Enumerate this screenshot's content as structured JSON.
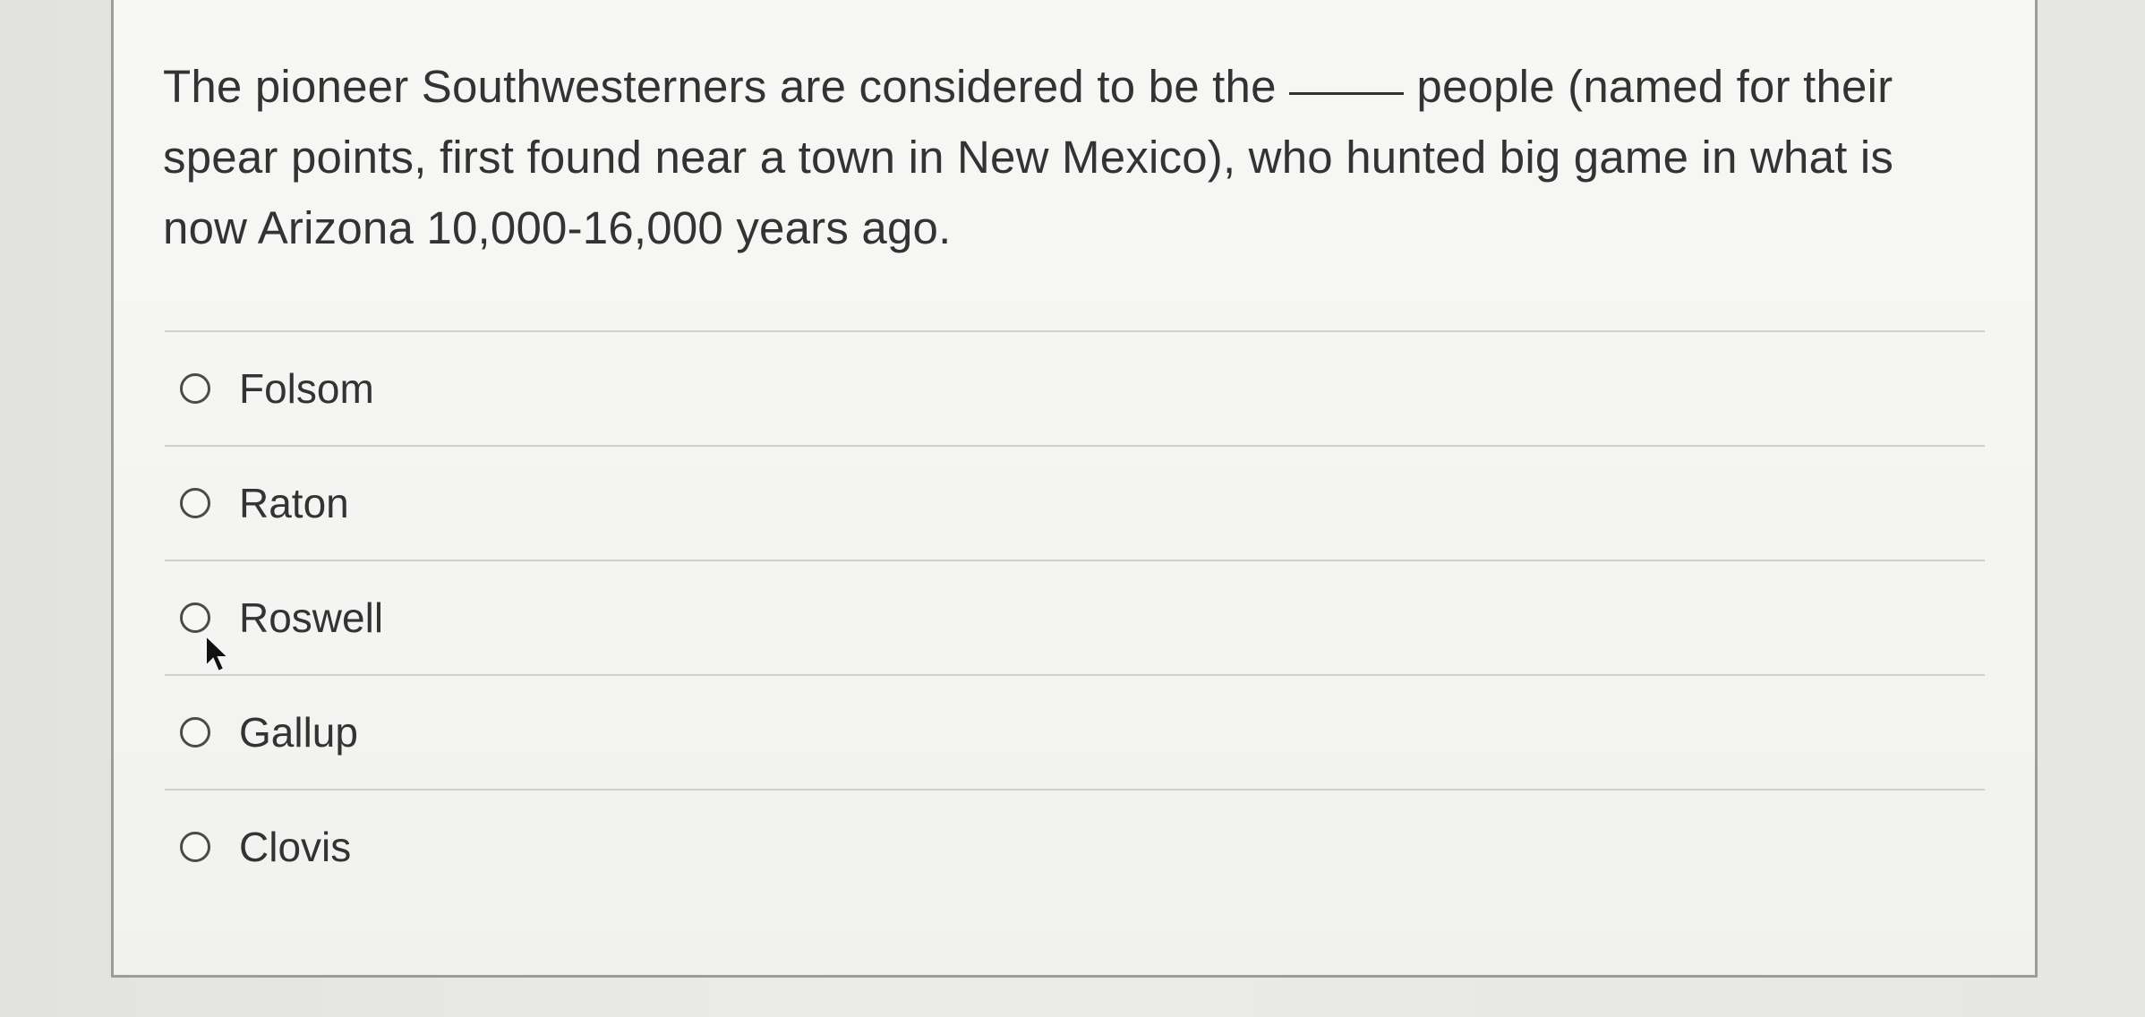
{
  "question": {
    "text_before": "The pioneer Southwesterners are considered to be the",
    "text_after": "people (named for their spear points, first found near a town in New Mexico), who hunted big game in what is now Arizona 10,000-16,000 years ago."
  },
  "options": [
    {
      "label": "Folsom"
    },
    {
      "label": "Raton"
    },
    {
      "label": "Roswell"
    },
    {
      "label": "Gallup"
    },
    {
      "label": "Clovis"
    }
  ],
  "colors": {
    "card_background": "#f7f7f5",
    "card_border": "#9c9c9a",
    "divider": "#cfcfcc",
    "text": "#333333"
  },
  "icons": {
    "radio": "radio-unchecked-icon",
    "cursor": "mouse-pointer-icon"
  }
}
